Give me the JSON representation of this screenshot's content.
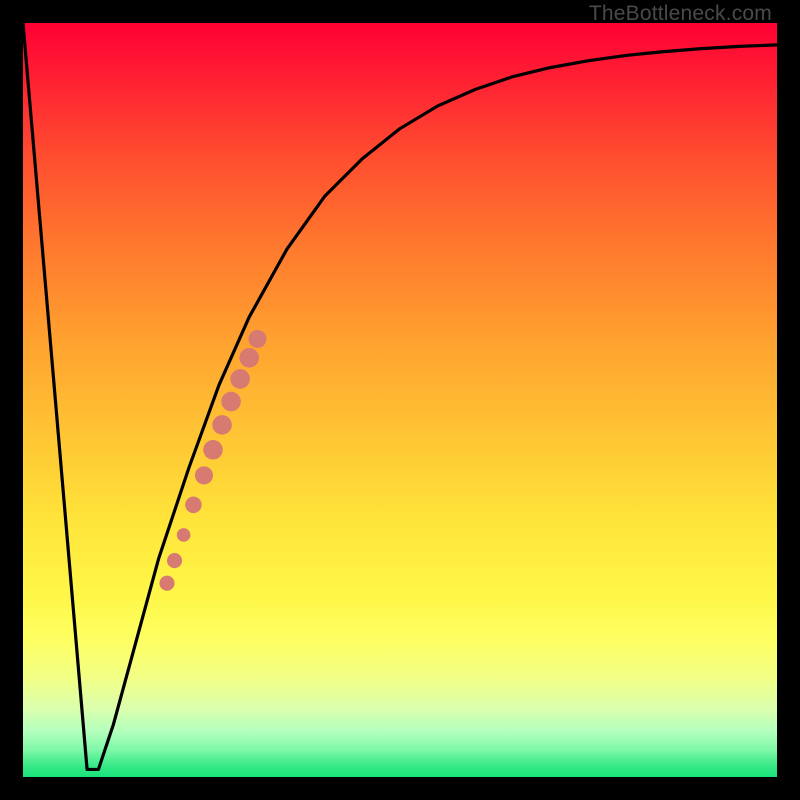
{
  "watermark": "TheBottleneck.com",
  "colors": {
    "curve_stroke": "#000000",
    "dot_fill": "#d77b72",
    "background_top": "#ff0033",
    "background_bottom": "#18e27b"
  },
  "chart_data": {
    "type": "line",
    "title": "",
    "xlabel": "",
    "ylabel": "",
    "xlim": [
      0,
      100
    ],
    "ylim": [
      0,
      100
    ],
    "grid": false,
    "legend": false,
    "background_gradient": "red-yellow-green vertical",
    "series": [
      {
        "name": "left-descent",
        "x": [
          0,
          8.5,
          10
        ],
        "y": [
          100,
          1,
          1
        ]
      },
      {
        "name": "right-rise",
        "x": [
          10,
          12,
          15,
          18,
          22,
          26,
          30,
          35,
          40,
          45,
          50,
          55,
          60,
          65,
          70,
          75,
          80,
          85,
          90,
          95,
          100
        ],
        "y": [
          1,
          7,
          18,
          29,
          41,
          52,
          61,
          70,
          77,
          82,
          86,
          89,
          91.2,
          92.9,
          94.1,
          95,
          95.7,
          96.2,
          96.6,
          96.9,
          97.1
        ]
      }
    ],
    "markers": {
      "name": "highlight-segment",
      "points": [
        {
          "x": 19.1,
          "y": 25.7,
          "r": 1.0
        },
        {
          "x": 20.1,
          "y": 28.7,
          "r": 1.0
        },
        {
          "x": 21.3,
          "y": 32.1,
          "r": 0.9
        },
        {
          "x": 22.6,
          "y": 36.1,
          "r": 1.1
        },
        {
          "x": 24.0,
          "y": 40.0,
          "r": 1.2
        },
        {
          "x": 25.2,
          "y": 43.4,
          "r": 1.3
        },
        {
          "x": 26.4,
          "y": 46.7,
          "r": 1.3
        },
        {
          "x": 27.6,
          "y": 49.8,
          "r": 1.3
        },
        {
          "x": 28.8,
          "y": 52.8,
          "r": 1.3
        },
        {
          "x": 30.0,
          "y": 55.6,
          "r": 1.3
        },
        {
          "x": 31.1,
          "y": 58.1,
          "r": 1.2
        }
      ]
    }
  }
}
